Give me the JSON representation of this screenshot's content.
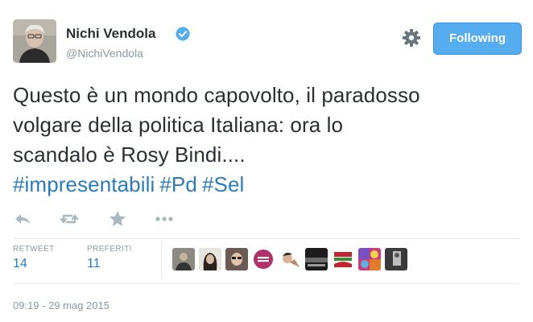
{
  "user": {
    "name": "Nichi Vendola",
    "handle": "@NichiVendola",
    "verified": true,
    "avatar_icon": "profile-photo"
  },
  "header": {
    "settings_icon": "gear-icon",
    "follow_label": "Following"
  },
  "tweet": {
    "text_lines": [
      "Questo è un mondo capovolto, il paradosso",
      "volgare della politica Italiana: ora lo",
      "scandalo è Rosy Bindi...."
    ],
    "hashtags": [
      "#impresentabili",
      "#Pd",
      "#Sel"
    ]
  },
  "actions": [
    {
      "name": "reply",
      "icon": "reply-icon"
    },
    {
      "name": "retweet",
      "icon": "retweet-icon"
    },
    {
      "name": "favorite",
      "icon": "star-icon"
    },
    {
      "name": "more",
      "icon": "more-icon"
    }
  ],
  "stats": {
    "retweet_label": "RETWEET",
    "retweet_count": "14",
    "favorites_label": "PREFERITI",
    "favorites_count": "11"
  },
  "timestamp": "09:19 - 29 mag 2015",
  "colors": {
    "accent": "#55acee",
    "link": "#2b7bb9",
    "muted": "#8899a6",
    "text": "#292f33",
    "divider": "#e1e8ed"
  }
}
